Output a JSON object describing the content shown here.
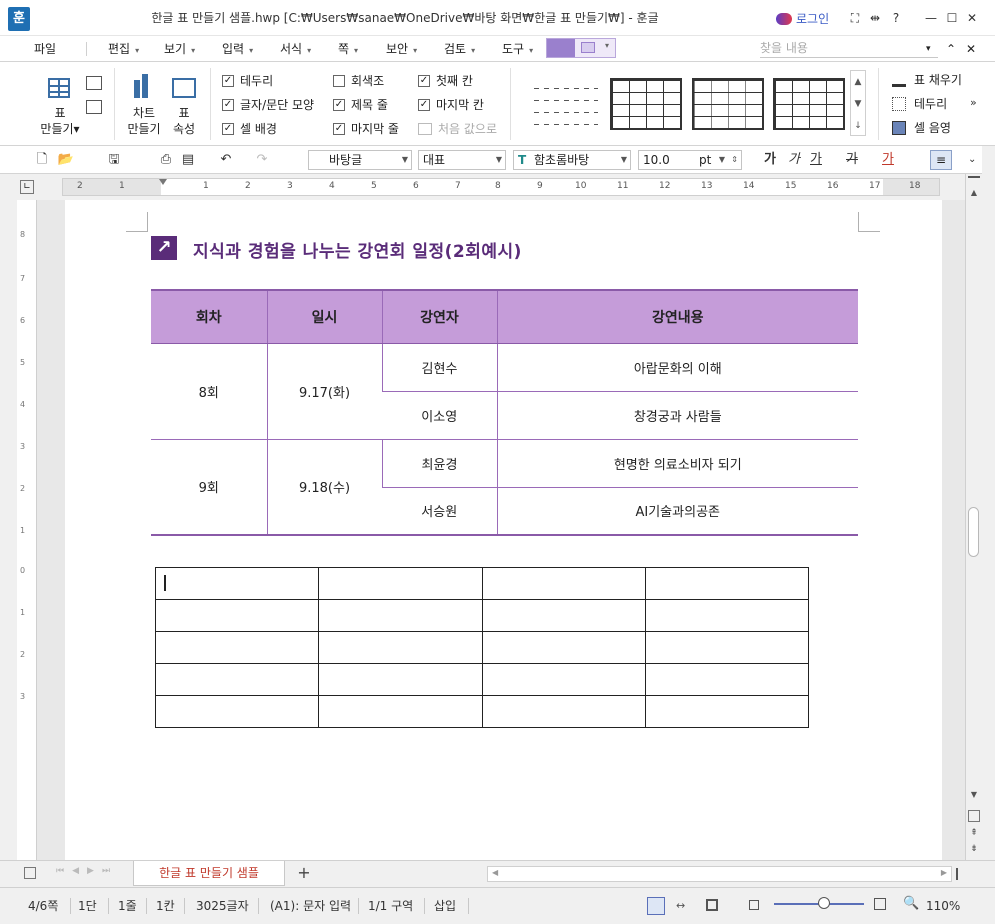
{
  "window": {
    "app_icon": "훈",
    "title": "한글 표 만들기 샘플.hwp [C:₩Users₩sanae₩OneDrive₩바탕 화면₩한글 표 만들기₩] - 훈글",
    "login": "로그인",
    "controls": [
      "⛶",
      "⇹",
      "?",
      "—",
      "☐",
      "✕"
    ]
  },
  "menu": {
    "items": [
      "파일",
      "편집",
      "보기",
      "입력",
      "서식",
      "쪽",
      "보안",
      "검토",
      "도구"
    ],
    "search_placeholder": "찾을 내용",
    "nav": [
      "▾",
      "⌃",
      "✕"
    ]
  },
  "ribbon": {
    "table_create": [
      "표",
      "만들기▾"
    ],
    "chart_create": [
      "차트",
      "만들기"
    ],
    "table_props": [
      "표",
      "속성"
    ],
    "checks": [
      {
        "label": "테두리",
        "checked": true
      },
      {
        "label": "글자/문단 모양",
        "checked": true
      },
      {
        "label": "셀 배경",
        "checked": true
      },
      {
        "label": "회색조",
        "checked": false
      },
      {
        "label": "제목 줄",
        "checked": true
      },
      {
        "label": "마지막 줄",
        "checked": true
      },
      {
        "label": "첫째 칸",
        "checked": true
      },
      {
        "label": "마지막 칸",
        "checked": true
      }
    ],
    "reset": "처음 값으로",
    "right": [
      "표 채우기",
      "테두리",
      "셀 음영"
    ]
  },
  "toolbar": {
    "style": "바탕글",
    "font_lang": "대표",
    "font": "함초롬바탕",
    "size": "10.0",
    "unit": "pt",
    "format_glyphs": [
      "가",
      "가",
      "가",
      "가",
      "가"
    ]
  },
  "ruler": {
    "h_ticks": [
      "2",
      "1",
      "1",
      "2",
      "3",
      "4",
      "5",
      "6",
      "7",
      "8",
      "9",
      "10",
      "11",
      "12",
      "13",
      "14",
      "15",
      "16",
      "17",
      "18"
    ],
    "v_ticks": [
      "8",
      "7",
      "6",
      "5",
      "4",
      "3",
      "2",
      "1",
      "0",
      "1",
      "2",
      "3"
    ]
  },
  "document": {
    "heading": "지식과 경험을 나누는 강연회 일정(2회예시)",
    "table": {
      "headers": [
        "회차",
        "일시",
        "강연자",
        "강연내용"
      ],
      "groups": [
        {
          "round": "8회",
          "date": "9.17(화)",
          "talks": [
            [
              "김현수",
              "아랍문화의 이해"
            ],
            [
              "이소영",
              "창경궁과 사람들"
            ]
          ]
        },
        {
          "round": "9회",
          "date": "9.18(수)",
          "talks": [
            [
              "최윤경",
              "현명한 의료소비자 되기"
            ],
            [
              "서승원",
              "AI기술과의공존"
            ]
          ]
        }
      ]
    },
    "blank_table": {
      "rows": 5,
      "cols": 4
    }
  },
  "tabs": {
    "doc_tab": "한글 표 만들기 샘플",
    "add": "+"
  },
  "status": {
    "page": "4/6쪽",
    "column": "1단",
    "line": "1줄",
    "cell": "1칸",
    "chars": "3025글자",
    "cell_ref": "(A1): 문자 입력",
    "section": "1/1 구역",
    "mode": "삽입",
    "zoom": "110%",
    "zoom_level": 0.55
  },
  "colors": {
    "accent": "#5a2c79",
    "header_fill": "#c59cd9",
    "border": "#9a6ab8",
    "tab_text": "#c0392b"
  }
}
